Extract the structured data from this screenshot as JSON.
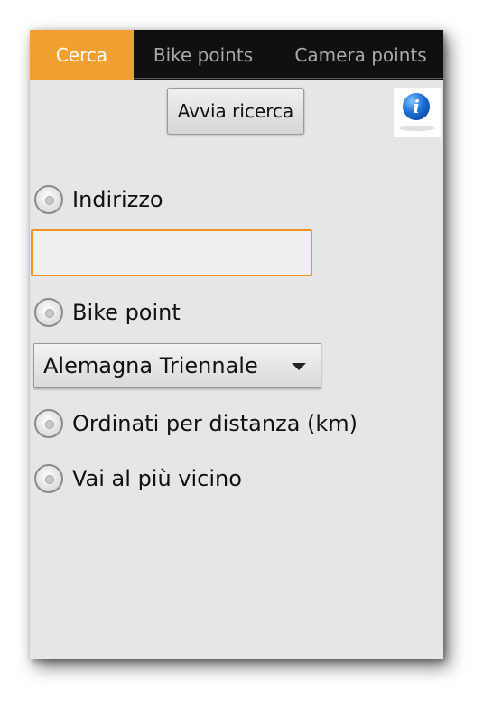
{
  "tabs": [
    {
      "label": "Cerca",
      "active": true
    },
    {
      "label": "Bike points",
      "active": false
    },
    {
      "label": "Camera points",
      "active": false
    }
  ],
  "toolbar": {
    "search_button": "Avvia ricerca",
    "info_icon": "i"
  },
  "options": {
    "address": "Indirizzo",
    "bike_point": "Bike point",
    "sorted_by_distance": "Ordinati per distanza (km)",
    "nearest": "Vai al più vicino"
  },
  "address_input": {
    "value": "",
    "placeholder": ""
  },
  "bike_point_select": {
    "selected": "Alemagna Triennale"
  },
  "colors": {
    "accent": "#f0a030",
    "focus_border": "#f0921e",
    "tabbar": "#101010"
  }
}
